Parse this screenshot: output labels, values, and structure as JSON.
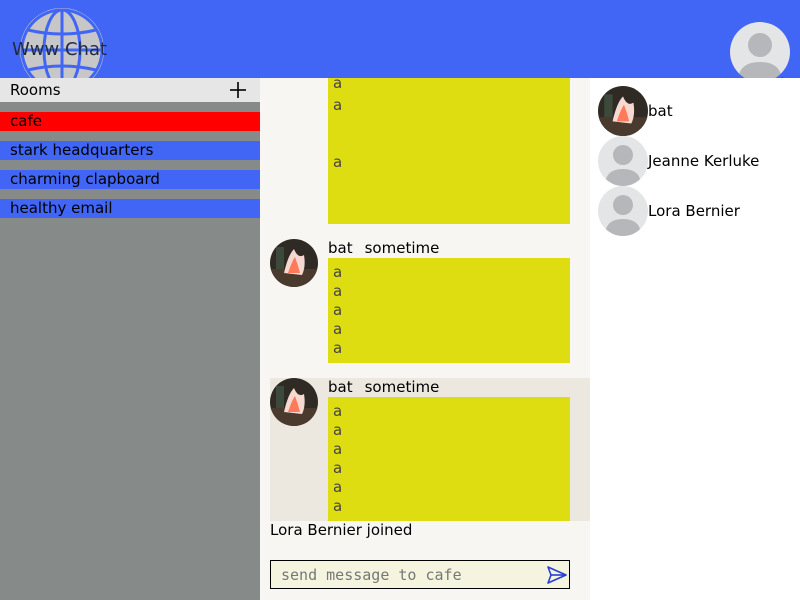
{
  "app": {
    "title": "Www Chat"
  },
  "colors": {
    "header": "#4166f5",
    "room_active": "#ff0000",
    "room_normal": "#4166f5",
    "message_bg": "#dddd11",
    "sidebar_bg": "#868a89"
  },
  "sidebar": {
    "rooms_label": "Rooms",
    "add_icon": "plus-icon",
    "rooms": [
      {
        "label": "cafe",
        "active": true
      },
      {
        "label": "stark headquarters",
        "active": false
      },
      {
        "label": "charming clapboard",
        "active": false
      },
      {
        "label": "healthy email",
        "active": false
      }
    ]
  },
  "messages": [
    {
      "lines": [
        "a",
        "a",
        "a"
      ]
    },
    {
      "user": "bat",
      "time": "sometime",
      "lines": [
        "a",
        "a",
        "a",
        "a",
        "a"
      ]
    },
    {
      "user": "bat",
      "time": "sometime",
      "lines": [
        "a",
        "a",
        "a",
        "a",
        "a",
        "a"
      ]
    }
  ],
  "system_message": "Lora Bernier joined",
  "composer": {
    "placeholder": "send message to cafe",
    "send_icon": "send-icon"
  },
  "users": [
    {
      "name": "bat",
      "avatar": "photo"
    },
    {
      "name": "Jeanne Kerluke",
      "avatar": "default"
    },
    {
      "name": "Lora Bernier",
      "avatar": "default"
    }
  ]
}
